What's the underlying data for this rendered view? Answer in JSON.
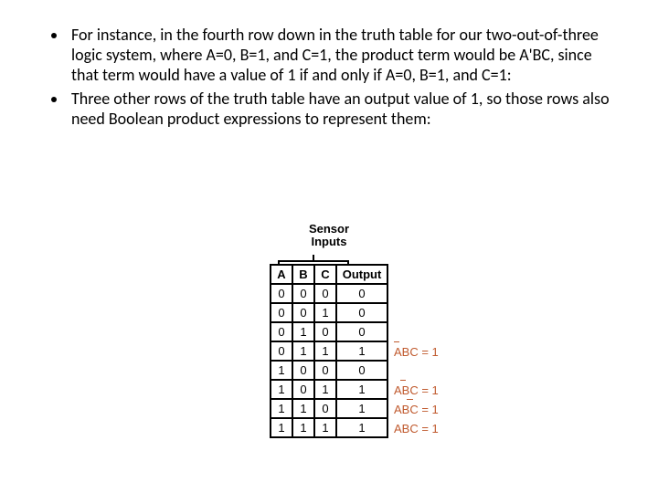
{
  "bullets": [
    "For instance, in the fourth row down in the truth table for our two-out-of-three logic system, where A=0, B=1, and C=1, the product term would be A'BC, since that term would have a value of 1 if and only if A=0, B=1, and C=1:",
    "Three other rows of the truth table have an output value of 1, so those rows also need Boolean product expressions to represent them:"
  ],
  "truth_table": {
    "title_line1": "Sensor",
    "title_line2": "Inputs",
    "headers": [
      "A",
      "B",
      "C",
      "Output"
    ],
    "rows": [
      [
        "0",
        "0",
        "0",
        "0"
      ],
      [
        "0",
        "0",
        "1",
        "0"
      ],
      [
        "0",
        "1",
        "0",
        "0"
      ],
      [
        "0",
        "1",
        "1",
        "1"
      ],
      [
        "1",
        "0",
        "0",
        "0"
      ],
      [
        "1",
        "0",
        "1",
        "1"
      ],
      [
        "1",
        "1",
        "0",
        "1"
      ],
      [
        "1",
        "1",
        "1",
        "1"
      ]
    ]
  },
  "annotations": [
    {
      "row": 3,
      "bars": "A",
      "expr_text": "ABC = 1"
    },
    {
      "row": 5,
      "bars": "B",
      "expr_text": "ABC = 1"
    },
    {
      "row": 6,
      "bars": "C",
      "expr_text": "ABC = 1"
    },
    {
      "row": 7,
      "bars": "",
      "expr_text": "ABC = 1"
    }
  ],
  "chart_data": {
    "type": "table",
    "title": "Sensor Inputs truth table",
    "columns": [
      "A",
      "B",
      "C",
      "Output"
    ],
    "rows": [
      {
        "A": 0,
        "B": 0,
        "C": 0,
        "Output": 0
      },
      {
        "A": 0,
        "B": 0,
        "C": 1,
        "Output": 0
      },
      {
        "A": 0,
        "B": 1,
        "C": 0,
        "Output": 0
      },
      {
        "A": 0,
        "B": 1,
        "C": 1,
        "Output": 1,
        "product_term": "A'BC"
      },
      {
        "A": 1,
        "B": 0,
        "C": 0,
        "Output": 0
      },
      {
        "A": 1,
        "B": 0,
        "C": 1,
        "Output": 1,
        "product_term": "AB'C"
      },
      {
        "A": 1,
        "B": 1,
        "C": 0,
        "Output": 1,
        "product_term": "ABC'"
      },
      {
        "A": 1,
        "B": 1,
        "C": 1,
        "Output": 1,
        "product_term": "ABC"
      }
    ]
  }
}
